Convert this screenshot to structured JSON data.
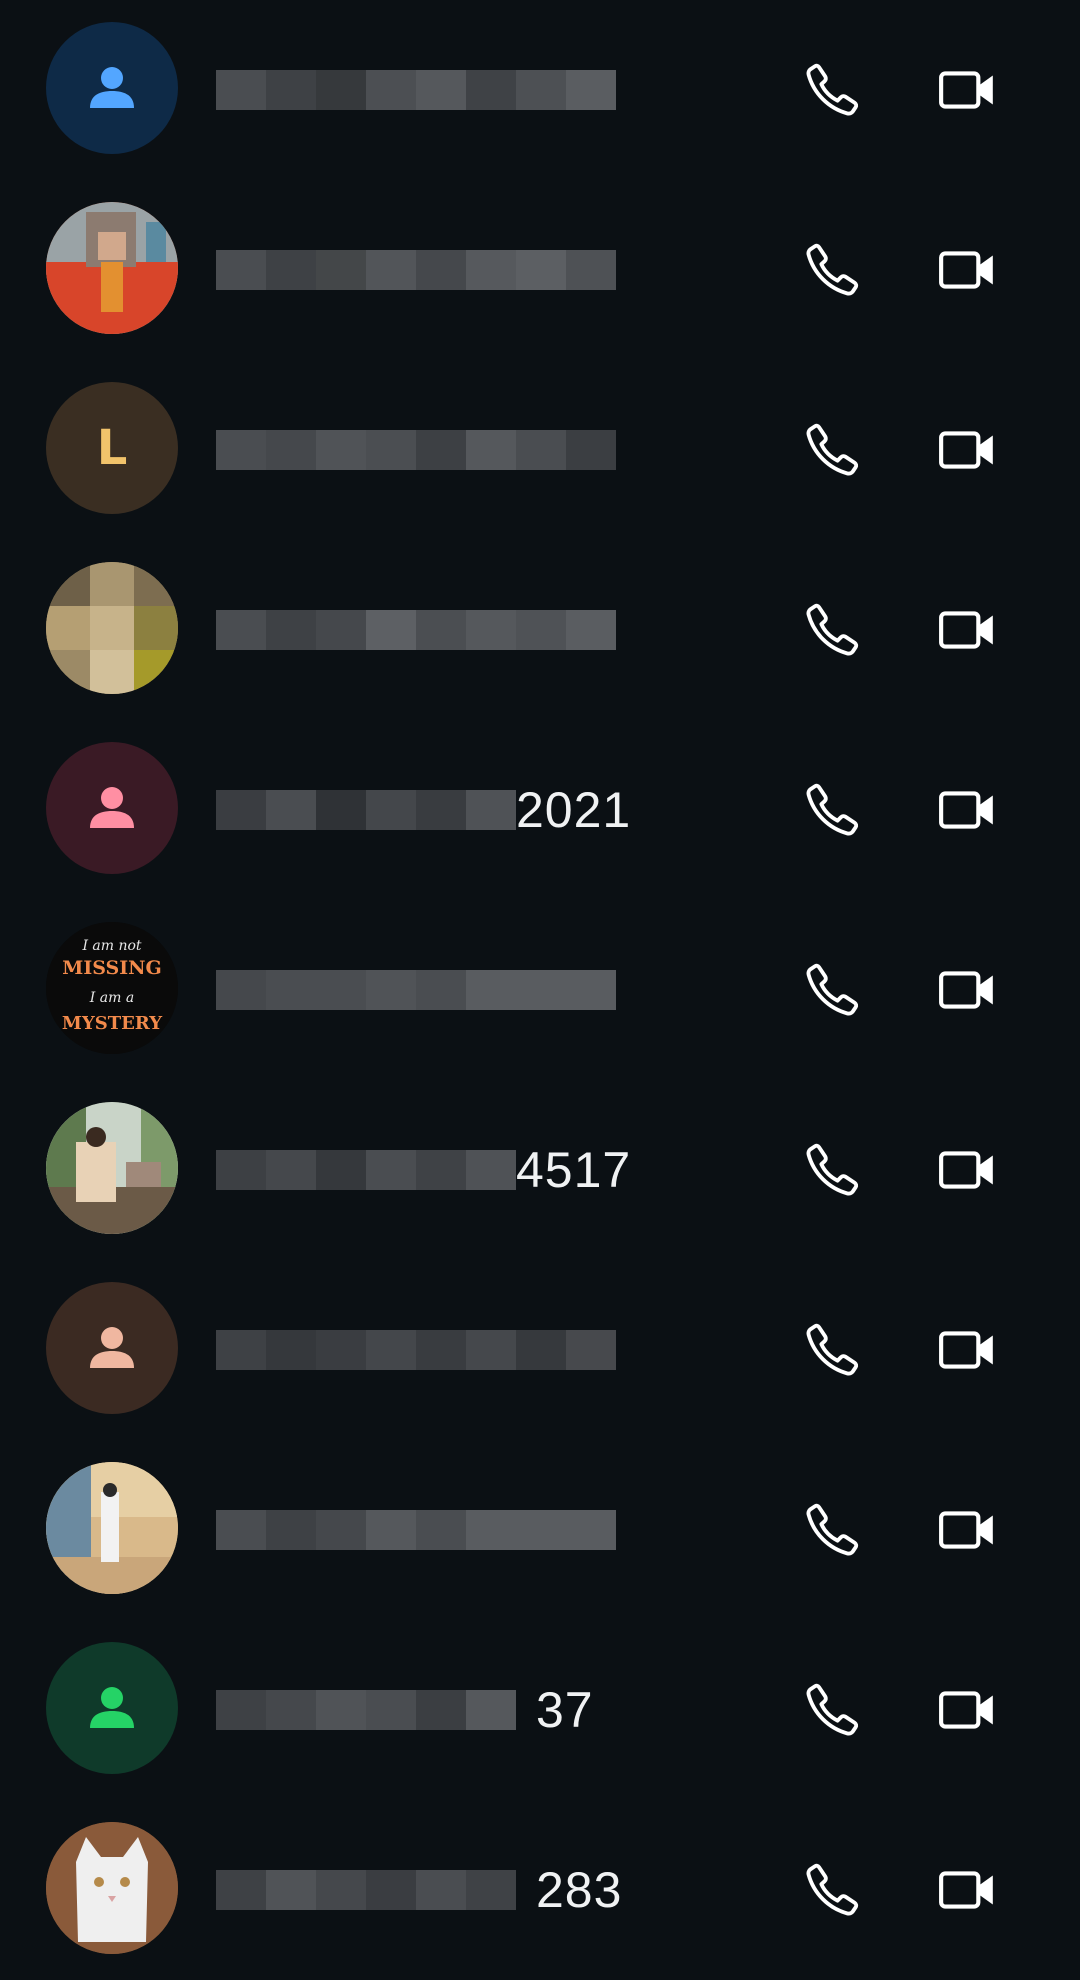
{
  "contacts": [
    {
      "avatar": "default-person-icon",
      "avatar_bg": "#0e2a47",
      "avatar_fg": "#53a6ff",
      "name_visible": ""
    },
    {
      "avatar": "photo-person-red-jacket",
      "avatar_bg": "#c9562e",
      "name_visible": ""
    },
    {
      "avatar": "letter",
      "letter": "L",
      "avatar_bg": "#3a2e22",
      "avatar_fg": "#f1c36b",
      "name_visible": ""
    },
    {
      "avatar": "photo-blurred",
      "avatar_bg": "#8a7a55",
      "name_visible": ""
    },
    {
      "avatar": "default-person-icon",
      "avatar_bg": "#3a1a25",
      "avatar_fg": "#ff8fa3",
      "name_visible": "2021"
    },
    {
      "avatar": "image-text-missing-mystery",
      "avatar_bg": "#0a0a0a",
      "avatar_text": [
        "I am not",
        "MISSING",
        "I am a",
        "MYSTERY"
      ],
      "name_visible": ""
    },
    {
      "avatar": "photo-person-outdoor",
      "avatar_bg": "#7b8d6a",
      "name_visible": "4517"
    },
    {
      "avatar": "default-person-icon",
      "avatar_bg": "#3b2a22",
      "avatar_fg": "#f0b7a0",
      "name_visible": ""
    },
    {
      "avatar": "photo-person-wall",
      "avatar_bg": "#b8a17a",
      "name_visible": ""
    },
    {
      "avatar": "default-person-icon",
      "avatar_bg": "#0f3a2a",
      "avatar_fg": "#25d366",
      "name_visible": "37"
    },
    {
      "avatar": "photo-white-cat",
      "avatar_bg": "#8a5a3a",
      "name_visible": "283"
    }
  ],
  "icons": {
    "call": "phone-icon",
    "video": "video-camera-icon"
  },
  "colors": {
    "background": "#0b1014",
    "icon": "#ffffff",
    "text": "#f0f2f3"
  }
}
